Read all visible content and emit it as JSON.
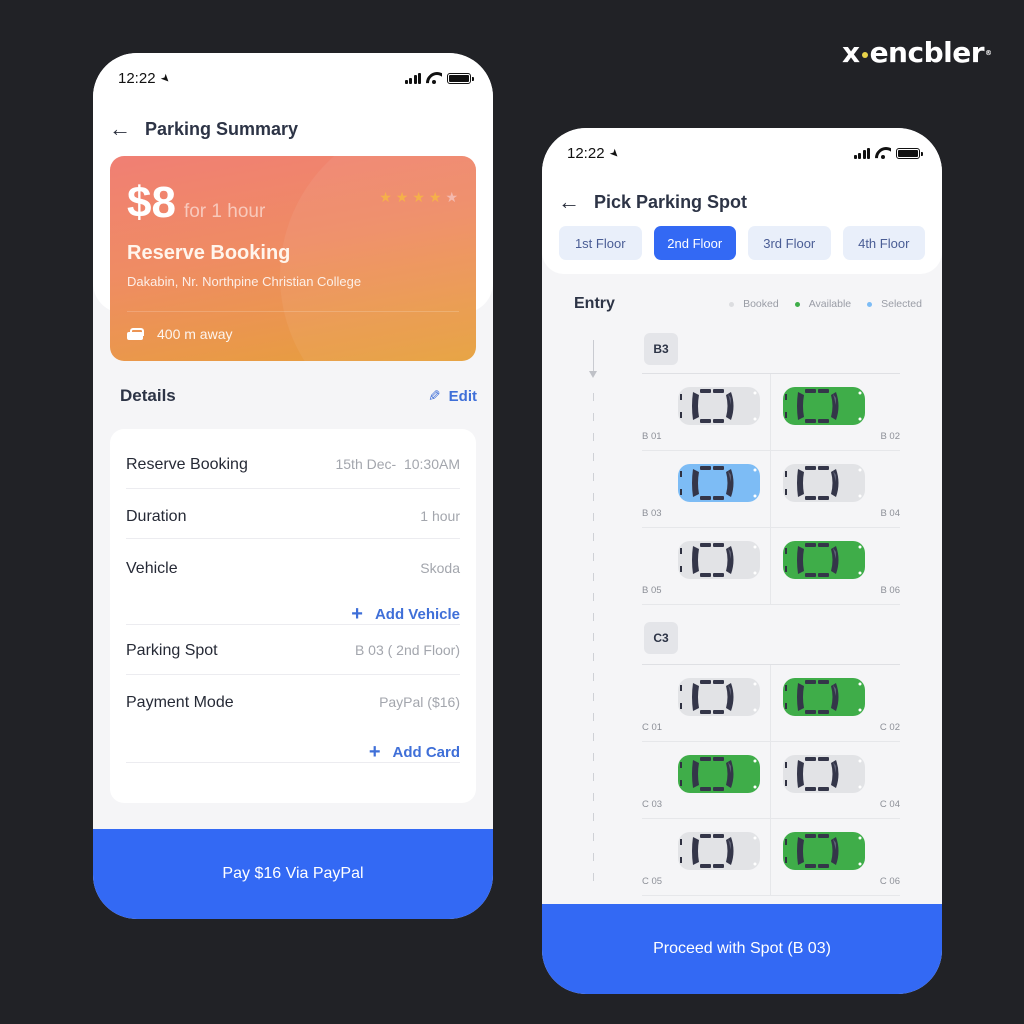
{
  "brand": {
    "name_left": "x",
    "name_right": "encbler",
    "registered": "®"
  },
  "colors": {
    "accent": "#3369f4",
    "booked": "#e2e3e6",
    "available": "#3fad49",
    "selected": "#7dbcf5",
    "link": "#3f6fd8"
  },
  "left_phone": {
    "status": {
      "time": "12:22"
    },
    "header": {
      "title": "Parking Summary",
      "back_icon": "arrow-left-icon"
    },
    "summary_card": {
      "price": "$8",
      "per": "for 1 hour",
      "rating": {
        "value": 4,
        "max": 5
      },
      "title": "Reserve Booking",
      "address": "Dakabin, Nr. Northpine Christian College",
      "distance": "400 m away",
      "distance_icon": "taxi-icon"
    },
    "details": {
      "title": "Details",
      "edit_label": "Edit",
      "rows": [
        {
          "label": "Reserve Booking",
          "value": "15th Dec-  10:30AM"
        },
        {
          "label": "Duration",
          "value": "1 hour"
        },
        {
          "label": "Vehicle",
          "value": "Skoda",
          "action": "Add Vehicle"
        },
        {
          "label": "Parking Spot",
          "value": "B 03 ( 2nd Floor)"
        },
        {
          "label": "Payment Mode",
          "value": "PayPal ($16)",
          "action": "Add Card"
        }
      ]
    },
    "cta": "Pay $16 Via PayPal"
  },
  "right_phone": {
    "status": {
      "time": "12:22"
    },
    "header": {
      "title": "Pick Parking Spot",
      "back_icon": "arrow-left-icon"
    },
    "floors": [
      {
        "label": "1st Floor",
        "active": false
      },
      {
        "label": "2nd Floor",
        "active": true
      },
      {
        "label": "3rd Floor",
        "active": false
      },
      {
        "label": "4th Floor",
        "active": false
      }
    ],
    "entry_label": "Entry",
    "legend": [
      {
        "label": "Booked",
        "color": "#e2e3e6"
      },
      {
        "label": "Available",
        "color": "#3fad49"
      },
      {
        "label": "Selected",
        "color": "#7dbcf5"
      }
    ],
    "zones": [
      {
        "name": "B3",
        "spots": [
          {
            "id": "B 01",
            "status": "booked"
          },
          {
            "id": "B 02",
            "status": "available"
          },
          {
            "id": "B 03",
            "status": "selected"
          },
          {
            "id": "B 04",
            "status": "booked"
          },
          {
            "id": "B 05",
            "status": "booked"
          },
          {
            "id": "B 06",
            "status": "available"
          }
        ]
      },
      {
        "name": "C3",
        "spots": [
          {
            "id": "C 01",
            "status": "booked"
          },
          {
            "id": "C 02",
            "status": "available"
          },
          {
            "id": "C 03",
            "status": "available"
          },
          {
            "id": "C 04",
            "status": "booked"
          },
          {
            "id": "C 05",
            "status": "booked"
          },
          {
            "id": "C 06",
            "status": "available"
          }
        ]
      }
    ],
    "cta": "Proceed with Spot (B 03)"
  }
}
